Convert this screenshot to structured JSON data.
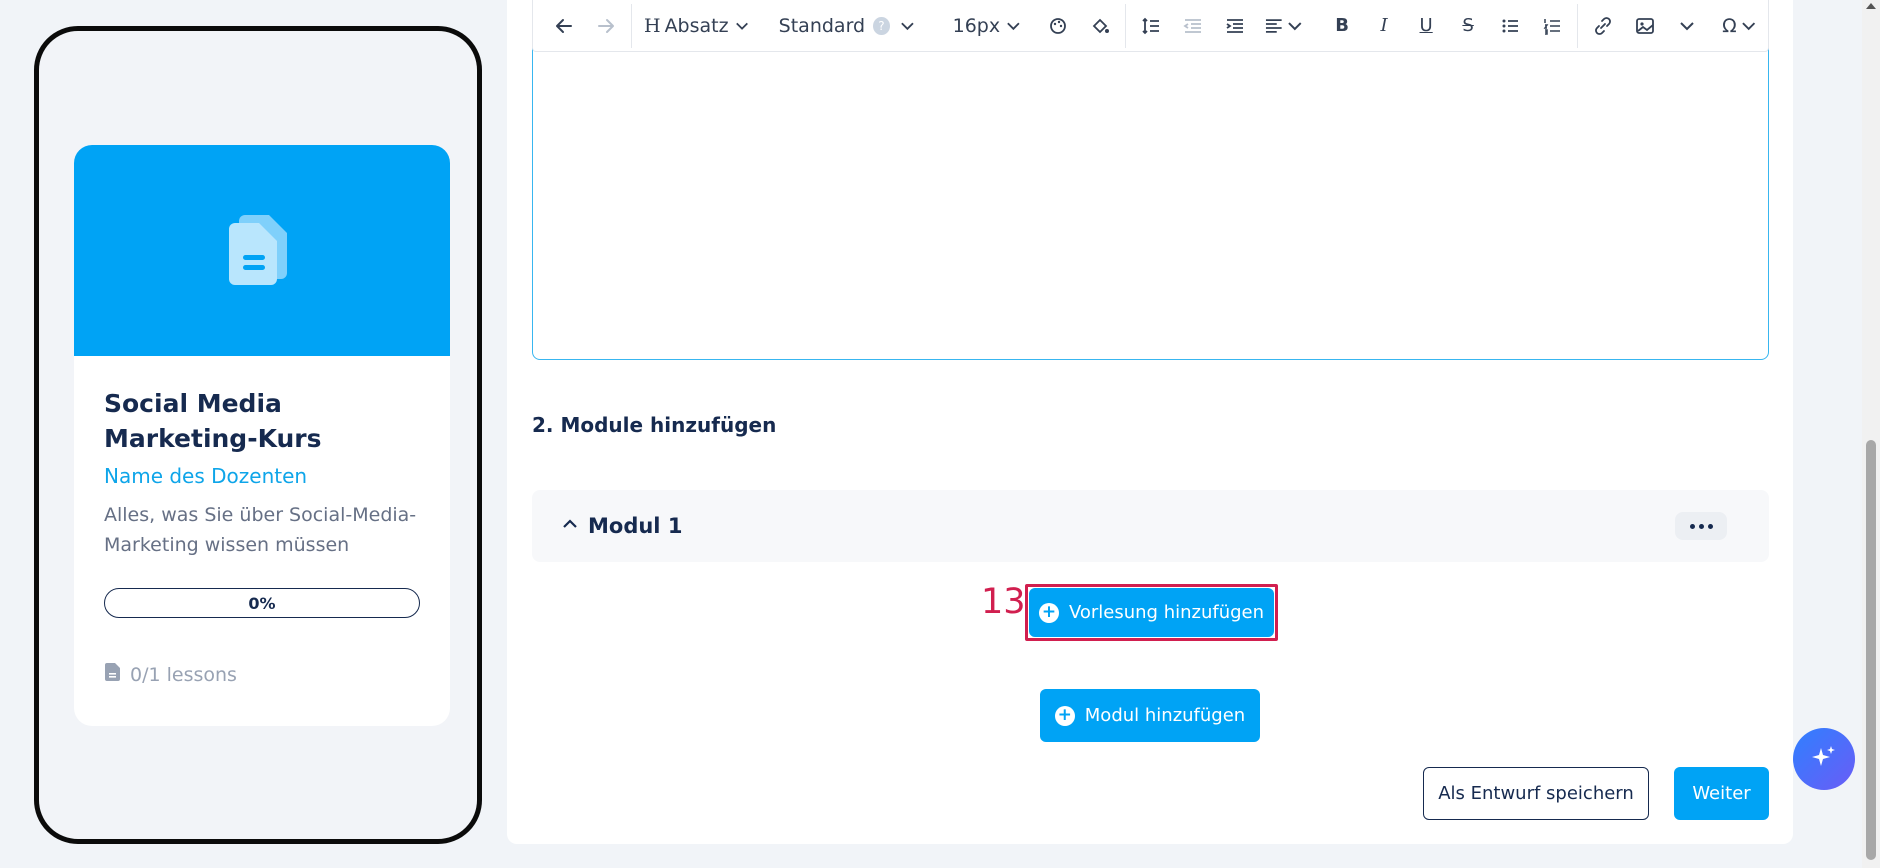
{
  "preview": {
    "course_title": "Social Media Marketing-Kurs",
    "instructor": "Name des Dozenten",
    "description": "Alles, was Sie über Social-Media-Marketing wissen müssen",
    "progress_text": "0%",
    "progress_value": 0,
    "lessons_text": "0/1 lessons",
    "icon": "document-icon"
  },
  "toolbar": {
    "heading_label": "Absatz",
    "font_label": "Standard",
    "help_glyph": "?",
    "size_label": "16px",
    "bold_glyph": "B",
    "italic_glyph": "I",
    "underline_glyph": "U",
    "strike_glyph": "S",
    "special_glyph": "Ω",
    "heading_glyph": "H"
  },
  "section": {
    "title": "2. Module hinzufügen"
  },
  "module": {
    "title": "Modul 1"
  },
  "annotation": {
    "step": "13"
  },
  "buttons": {
    "add_lecture": "Vorlesung hinzufügen",
    "add_module": "Modul hinzufügen",
    "save_draft": "Als Entwurf speichern",
    "next": "Weiter"
  },
  "colors": {
    "accent": "#00a3f5",
    "navy": "#162a4f",
    "highlight": "#d11f4f"
  }
}
